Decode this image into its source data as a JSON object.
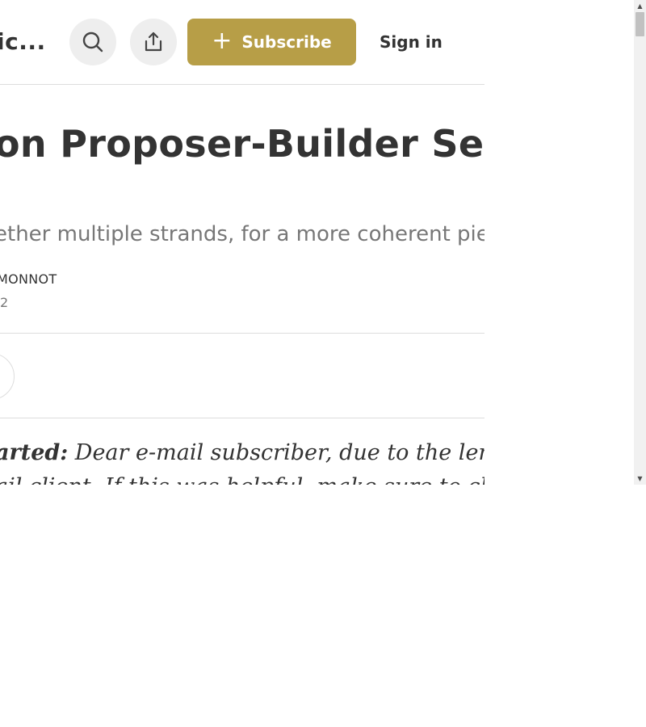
{
  "header": {
    "site_name": "ic...",
    "search_icon": "search-icon",
    "share_icon": "share-icon",
    "subscribe_label": "Subscribe",
    "subscribe_plus": "+",
    "signin_label": "Sign in"
  },
  "post": {
    "title": "on Proposer-Builder Sep",
    "subtitle": "ether multiple strands, for a more coherent pie",
    "author": "MONNOT",
    "date": "2",
    "body_lead": "arted:",
    "body_line1": " Dear e-mail subscriber, due to the length of this",
    "body_line2": "ail client. If this was helpful, make sure to check"
  },
  "colors": {
    "accent": "#b79e47",
    "text": "#333333",
    "muted": "#777777",
    "divider": "#dddddd"
  }
}
